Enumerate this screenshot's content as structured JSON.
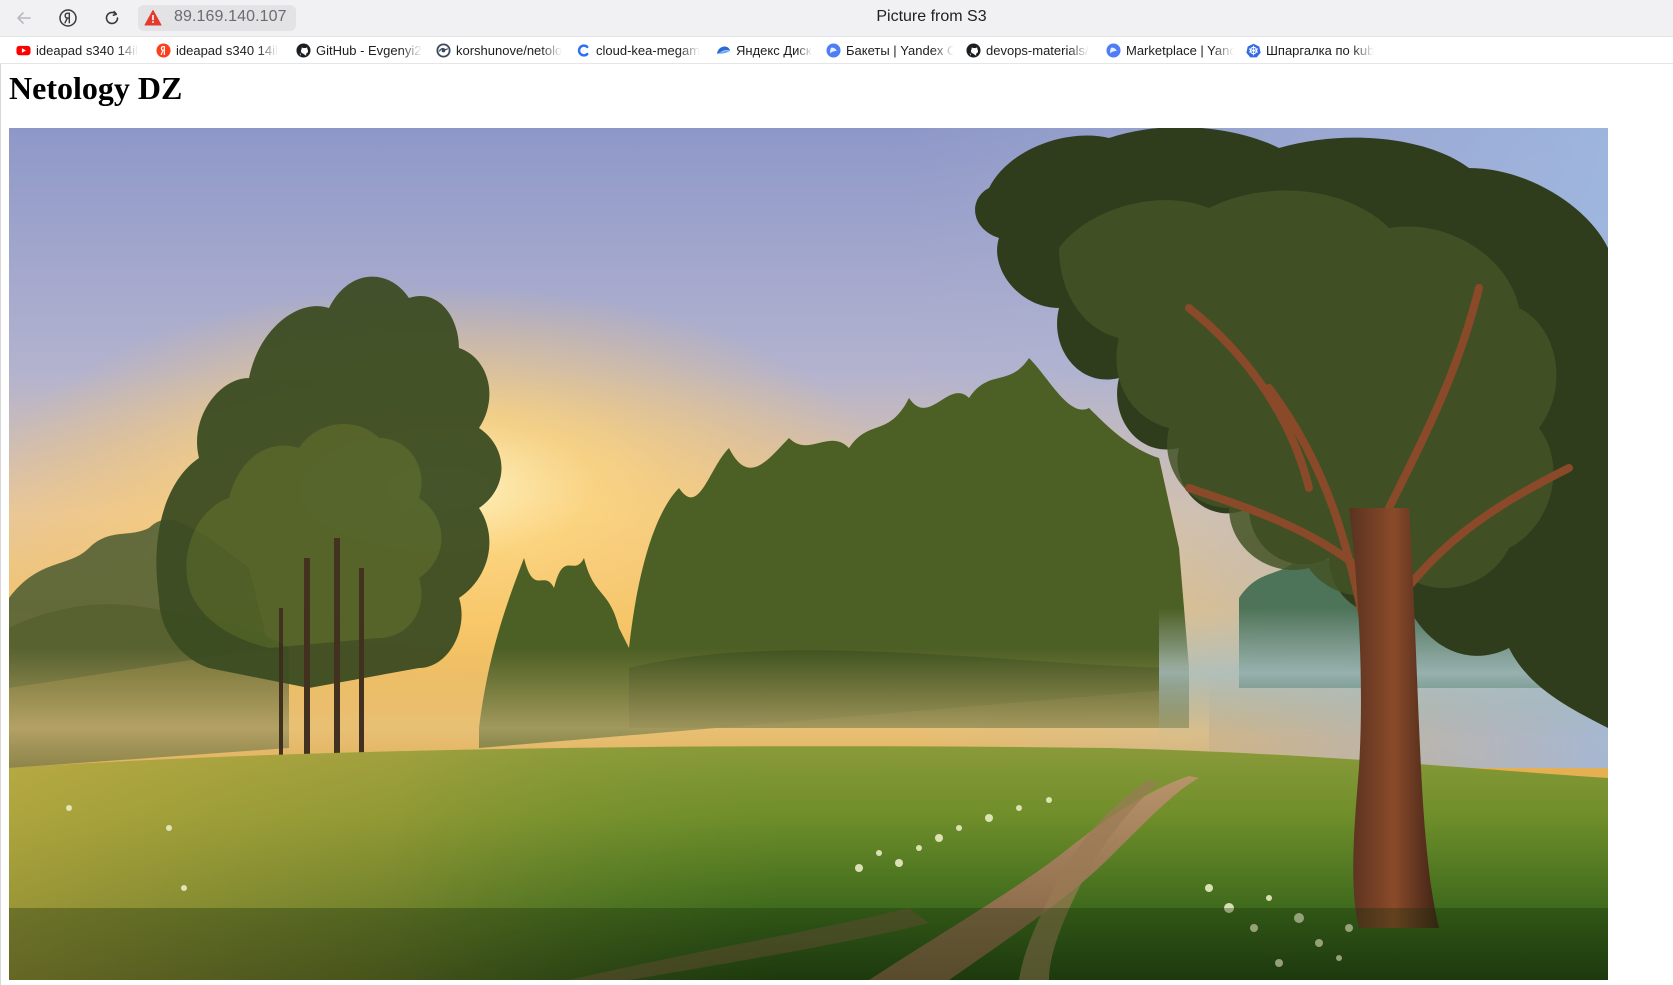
{
  "browser": {
    "url": "89.169.140.107",
    "tab_title": "Picture from S3",
    "bookmarks": [
      {
        "label": "ideapad s340 14il",
        "icon": "youtube-icon"
      },
      {
        "label": "ideapad s340 14il",
        "icon": "yandex-icon"
      },
      {
        "label": "GitHub - Evgenyi2",
        "icon": "github-icon"
      },
      {
        "label": "korshunove/netolo",
        "icon": "gitlab-icon"
      },
      {
        "label": "cloud-kea-megam",
        "icon": "cloud-icon"
      },
      {
        "label": "Яндекс Диск",
        "icon": "yandex-disk-icon"
      },
      {
        "label": "Бакеты | Yandex C",
        "icon": "yandex-cloud-icon"
      },
      {
        "label": "devops-materials/",
        "icon": "github-icon"
      },
      {
        "label": "Marketplace | Yanc",
        "icon": "yandex-cloud-icon"
      },
      {
        "label": "Шпаргалка по kub",
        "icon": "kubernetes-icon"
      }
    ]
  },
  "page": {
    "heading": "Netology DZ",
    "image_alt": ""
  },
  "colors": {
    "warning": "#e23b2e",
    "toolbar_bg": "#f1f1f3",
    "url_pill": "#e3e3e6"
  }
}
